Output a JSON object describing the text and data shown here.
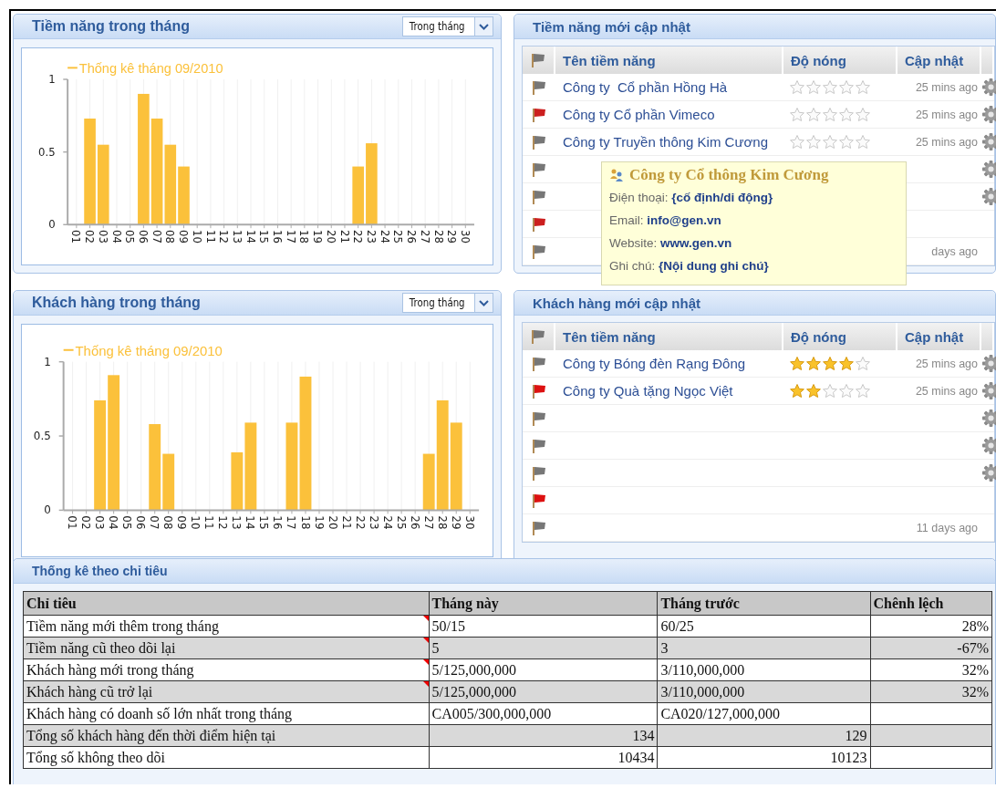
{
  "potential_chart": {
    "title": "Tiềm năng trong tháng",
    "period_select": {
      "value": "Trong tháng"
    },
    "chart_data": {
      "type": "bar",
      "grid": true,
      "categories": [
        "01",
        "02",
        "03",
        "04",
        "05",
        "06",
        "07",
        "08",
        "09",
        "10",
        "11",
        "12",
        "13",
        "14",
        "15",
        "16",
        "17",
        "18",
        "19",
        "20",
        "21",
        "22",
        "23",
        "24",
        "25",
        "26",
        "27",
        "28",
        "29",
        "30"
      ],
      "ylim": [
        0,
        1
      ],
      "yticks": [
        0,
        0.5,
        1
      ],
      "series": [
        {
          "name": "Thống kê tháng 09/2010",
          "color": "#fbc13b",
          "values": [
            0,
            0.73,
            0.55,
            0,
            0,
            0.9,
            0.73,
            0.55,
            0.4,
            0,
            0,
            0,
            0,
            0,
            0,
            0,
            0,
            0,
            0,
            0,
            0,
            0.4,
            0.56,
            0,
            0,
            0,
            0,
            0,
            0,
            0
          ]
        }
      ]
    }
  },
  "potential_updates": {
    "title": "Tiềm năng mới cập nhật",
    "columns": [
      "Tên tiềm năng",
      "Độ nóng",
      "Cập nhật"
    ],
    "rows": [
      {
        "color": "#777777",
        "name": "Công ty  Cổ phần Hồng Hà",
        "stars": 0,
        "updated": "25 mins ago",
        "has_actions": true
      },
      {
        "color": "#cc1f1f",
        "name": "Công ty Cổ phần Vimeco",
        "stars": 0,
        "updated": "25 mins ago",
        "has_actions": true
      },
      {
        "color": "#777777",
        "name": "Công ty Truyền thông Kim Cương",
        "stars": 0,
        "updated": "25 mins ago",
        "has_actions": true
      },
      {
        "color": "#777777",
        "has_actions": true
      },
      {
        "color": "#777777",
        "has_actions": true
      },
      {
        "color": "#cc1f1f",
        "has_actions": false
      },
      {
        "color": "#777777",
        "updated": "days ago",
        "has_actions": false
      }
    ],
    "tooltip": {
      "title": "Công ty Cổ thông Kim Cương",
      "lines": [
        {
          "label": "Điện thoại:",
          "value": "{cố định/di động}"
        },
        {
          "label": "Email:",
          "value": "info@gen.vn"
        },
        {
          "label": "Website:",
          "value": "www.gen.vn"
        },
        {
          "label": "Ghi chú:",
          "value": "{Nội dung ghi chú}"
        }
      ]
    }
  },
  "customer_chart": {
    "title": "Khách hàng trong tháng",
    "period_select": {
      "value": "Trong tháng"
    },
    "chart_data": {
      "type": "bar",
      "grid": true,
      "categories": [
        "01",
        "02",
        "03",
        "04",
        "05",
        "06",
        "07",
        "08",
        "09",
        "10",
        "11",
        "12",
        "13",
        "14",
        "15",
        "16",
        "17",
        "18",
        "19",
        "20",
        "21",
        "22",
        "23",
        "24",
        "25",
        "26",
        "27",
        "28",
        "29",
        "30"
      ],
      "ylim": [
        0,
        1
      ],
      "yticks": [
        0,
        0.5,
        1
      ],
      "series": [
        {
          "name": "Thống kê tháng 09/2010",
          "color": "#fbc13b",
          "values": [
            0,
            0,
            0.74,
            0.91,
            0,
            0,
            0.58,
            0.38,
            0,
            0,
            0,
            0,
            0.39,
            0.59,
            0,
            0,
            0.59,
            0.9,
            0,
            0,
            0,
            0,
            0,
            0,
            0,
            0,
            0.38,
            0.74,
            0.59,
            0
          ]
        }
      ]
    }
  },
  "customer_updates": {
    "title": "Khách hàng  mới cập nhật",
    "columns": [
      "Tên tiềm năng",
      "Độ nóng",
      "Cập nhật"
    ],
    "rows": [
      {
        "color": "#777777",
        "name": "Công ty Bóng đèn Rạng Đông",
        "stars": 4,
        "updated": "25 mins ago",
        "has_actions": true
      },
      {
        "color": "#dd1111",
        "name": "Công ty Quà tặng Ngọc Việt",
        "stars": 2,
        "updated": "25 mins ago",
        "has_actions": true
      },
      {
        "color": "#777777",
        "has_actions": true
      },
      {
        "color": "#777777",
        "has_actions": true
      },
      {
        "color": "#777777",
        "has_actions": true
      },
      {
        "color": "#dd1111",
        "has_actions": false
      },
      {
        "color": "#777777",
        "updated": "11 days ago",
        "has_actions": false
      }
    ]
  },
  "stats": {
    "title": "Thống kê theo chỉ tiêu",
    "columns": [
      "Chỉ tiêu",
      "Tháng này",
      "Tháng trước",
      "Chênh lệch"
    ],
    "rows": [
      {
        "kind": "ratio",
        "comment": true,
        "cells": [
          "Tiềm năng mới thêm trong tháng",
          "50/15",
          "60/25",
          "28%"
        ]
      },
      {
        "kind": "ratio",
        "comment": true,
        "cells": [
          "Tiềm năng cũ theo dõi lại",
          "5",
          "3",
          "-67%"
        ]
      },
      {
        "kind": "ratio",
        "comment": true,
        "cells": [
          "Khách hàng mới trong tháng",
          "5/125,000,000",
          "3/110,000,000",
          "32%"
        ]
      },
      {
        "kind": "ratio",
        "comment": true,
        "cells": [
          "Khách hàng cũ trở lại",
          "5/125,000,000",
          "3/110,000,000",
          "32%"
        ]
      },
      {
        "kind": "ratio",
        "comment": false,
        "cells": [
          "Khách hàng có doanh số lớn nhất trong tháng",
          "CA005/300,000,000",
          "CA020/127,000,000"
        ]
      },
      {
        "kind": "count",
        "comment": false,
        "cells": [
          "Tổng số khách hàng đến thời điểm hiện tại",
          "134",
          "129"
        ]
      },
      {
        "kind": "count",
        "comment": false,
        "cells": [
          "Tổng số không theo dõi",
          "10434",
          "10123"
        ]
      }
    ]
  }
}
